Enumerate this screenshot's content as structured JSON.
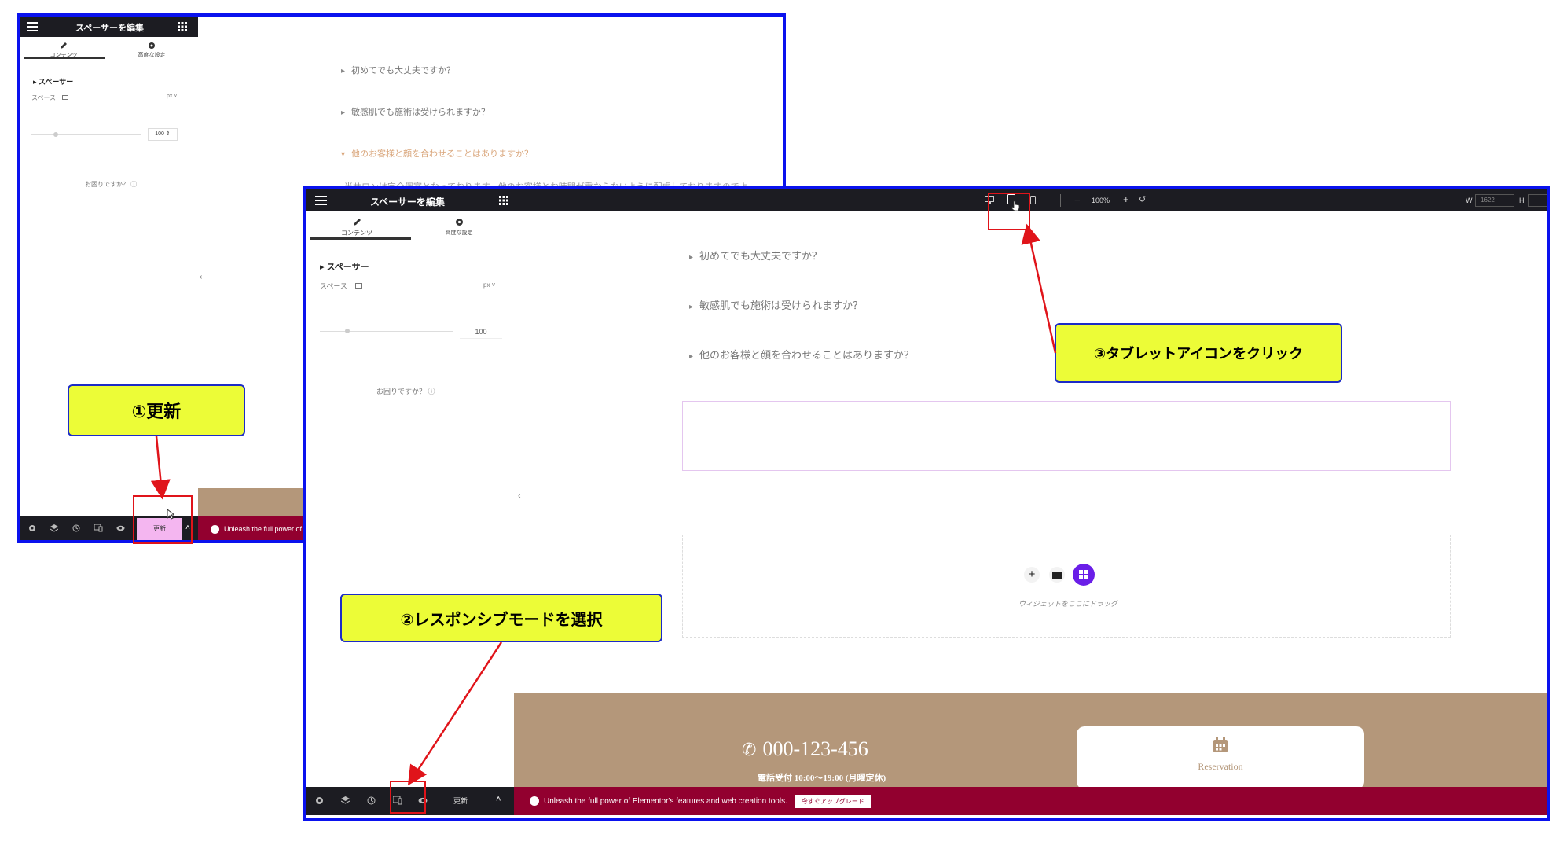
{
  "back_editor": {
    "header_title": "スペーサーを編集",
    "tabs": [
      {
        "label": "コンテンツ"
      },
      {
        "label": "高度な設定"
      }
    ],
    "section_title": "スペーサー",
    "space_label": "スペース",
    "unit": "px",
    "space_value": "100",
    "help_text": "お困りですか？",
    "faq": [
      {
        "text": "初めてでも大丈夫ですか？"
      },
      {
        "text": "敏感肌でも施術は受けられますか？"
      },
      {
        "text": "他のお客様と顔を合わせることはありますか？"
      }
    ],
    "faq_answer": "当サロンは完全個室となっております。他のお客様とお時間が重ならないように配慮しておりますのでよ",
    "update_label": "更新",
    "promo_text": "Unleash the full power of"
  },
  "front_editor": {
    "header_title": "スペーサーを編集",
    "zoom": "100%",
    "width_label": "W",
    "width_value": "1622",
    "height_label": "H",
    "tabs": [
      {
        "label": "コンテンツ"
      },
      {
        "label": "高度な設定"
      }
    ],
    "section_title": "スペーサー",
    "space_label": "スペース",
    "unit": "px",
    "space_value": "100",
    "help_text": "お困りですか？",
    "faq": [
      {
        "text": "初めてでも大丈夫ですか？"
      },
      {
        "text": "敏感肌でも施術は受けられますか？"
      },
      {
        "text": "他のお客様と顔を合わせることはありますか？"
      }
    ],
    "drop_hint": "ウィジェットをここにドラッグ",
    "phone": "000-123-456",
    "hours": "電話受付 10:00～19:00 (月曜定休)",
    "reservation": "Reservation",
    "update_label": "更新",
    "promo_text": "Unleash the full power of Elementor's features and web creation tools.",
    "upgrade_label": "今すぐアップグレード"
  },
  "callouts": {
    "step1": "①更新",
    "step2": "②レスポンシブモードを選択",
    "step3": "③タブレットアイコンをクリック"
  },
  "colors": {
    "frame_border": "#0a12ee",
    "callout_fill": "#ecfc37",
    "callout_border": "#1c2bc7",
    "red": "#e0141a",
    "promo_bar": "#92002f",
    "footer_tan": "#b4977a",
    "active_faq": "#d9a57a",
    "widget_purple": "#6a1ee8"
  },
  "icons": [
    "hamburger-icon",
    "grid-icon",
    "pencil-icon",
    "gear-icon",
    "desktop-icon",
    "tablet-icon",
    "mobile-icon",
    "minus-icon",
    "plus-icon",
    "undo-icon",
    "settings-icon",
    "layers-icon",
    "history-icon",
    "responsive-icon",
    "eye-icon",
    "chevron-up-icon",
    "phone-icon",
    "calendar-icon",
    "folder-icon",
    "cursor-icon",
    "help-icon"
  ]
}
